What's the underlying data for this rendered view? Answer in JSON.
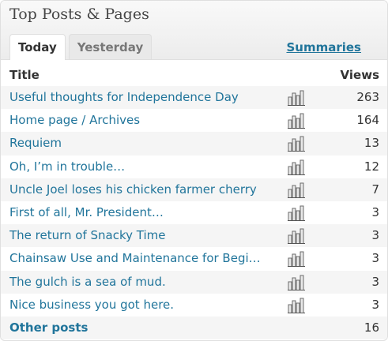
{
  "widget": {
    "title": "Top Posts & Pages",
    "tabs": [
      {
        "label": "Today",
        "active": true
      },
      {
        "label": "Yesterday",
        "active": false
      }
    ],
    "summaries_label": "Summaries"
  },
  "table": {
    "title_header": "Title",
    "views_header": "Views",
    "rows": [
      {
        "title": "Useful thoughts for Independence Day",
        "views": "263"
      },
      {
        "title": "Home page / Archives",
        "views": "164"
      },
      {
        "title": "Requiem",
        "views": "13"
      },
      {
        "title": "Oh, I’m in trouble…",
        "views": "12"
      },
      {
        "title": "Uncle Joel loses his chicken farmer cherry",
        "views": "7"
      },
      {
        "title": "First of all, Mr. President…",
        "views": "3"
      },
      {
        "title": "The return of Snacky Time",
        "views": "3"
      },
      {
        "title": "Chainsaw Use and Maintenance for Begi…",
        "views": "3"
      },
      {
        "title": "The gulch is a sea of mud.",
        "views": "3"
      },
      {
        "title": "Nice business you got here.",
        "views": "3"
      }
    ],
    "other": {
      "title": "Other posts",
      "views": "16"
    }
  },
  "colors": {
    "link": "#21759b",
    "row_alt": "#f5f5f5",
    "header_bg": "#ececec"
  },
  "icons": {
    "stats": "bar-chart-icon"
  }
}
